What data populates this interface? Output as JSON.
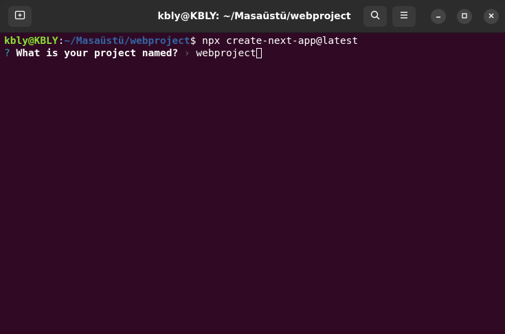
{
  "window": {
    "title": "kbly@KBLY: ~/Masaüstü/webproject"
  },
  "titlebar": {
    "new_tab_icon": "new-tab-icon",
    "search_icon": "search-icon",
    "menu_icon": "hamburger-menu-icon",
    "minimize_icon": "minimize-icon",
    "maximize_icon": "maximize-icon",
    "close_icon": "close-icon"
  },
  "terminal": {
    "prompt": {
      "user_host": "kbly@KBLY",
      "colon": ":",
      "path": "~/Masaüstü/webproject",
      "dollar": "$ ",
      "command": "npx create-next-app@latest"
    },
    "question": {
      "mark": "? ",
      "text": "What is your project named?",
      "separator": " › ",
      "answer": "webproject"
    }
  },
  "colors": {
    "terminal_bg": "#300a24",
    "titlebar_bg": "#2c2c2c",
    "user_host": "#8ae234",
    "path": "#3465a4",
    "question_mark": "#2aa1b3"
  }
}
